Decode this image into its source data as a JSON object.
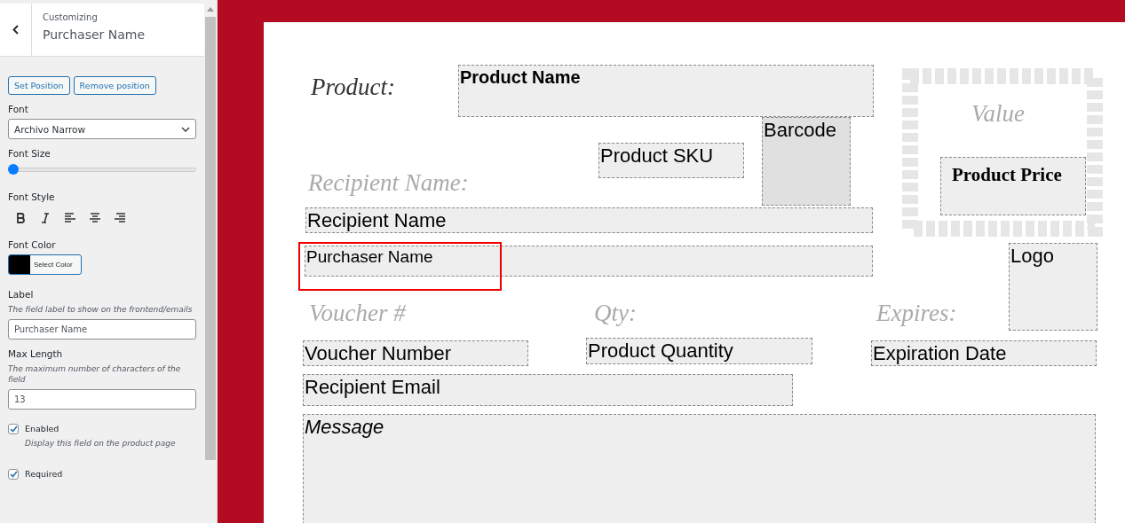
{
  "sidebar": {
    "header": {
      "breadcrumb": "Customizing",
      "title": "Purchaser Name"
    },
    "position_buttons": [
      "Set Position",
      "Remove position"
    ],
    "font": {
      "label": "Font",
      "value": "Archivo Narrow"
    },
    "font_size": {
      "label": "Font Size",
      "level": 0
    },
    "font_style": {
      "label": "Font Style",
      "buttons": [
        {
          "kind": "bold"
        },
        {
          "kind": "italic"
        },
        {
          "kind": "align-left"
        },
        {
          "kind": "align-center"
        },
        {
          "kind": "align-right"
        }
      ]
    },
    "font_color": {
      "label": "Font Color",
      "color": "#000000",
      "button": "Select Color"
    },
    "label_field": {
      "label": "Label",
      "description": "The field label to show on the frontend/emails",
      "value": "Purchaser Name"
    },
    "max_length": {
      "label": "Max Length",
      "description": "The maximum number of characters of the field",
      "value": "13"
    },
    "checkboxes": [
      {
        "label": "Enabled",
        "description": "Display this field on the product page",
        "checked": true
      },
      {
        "label": "Required",
        "checked": true
      }
    ]
  },
  "voucher": {
    "labels": [
      {
        "text": "Product:",
        "kind": "dark"
      },
      {
        "text": "Recipient Name:",
        "kind": "light"
      },
      {
        "text": "Value",
        "kind": "light"
      },
      {
        "text": "Voucher #",
        "kind": "light"
      },
      {
        "text": "Qty:",
        "kind": "light"
      },
      {
        "text": "Expires:",
        "kind": "light"
      }
    ],
    "fields": [
      {
        "text": "Product Name",
        "kind": "narrow-bold",
        "selected": false
      },
      {
        "text": "Barcode",
        "kind": "dark",
        "selected": false
      },
      {
        "text": "Product SKU",
        "kind": "plain",
        "selected": false
      },
      {
        "text": "Recipient Name",
        "kind": "plain",
        "selected": false
      },
      {
        "text": "Purchaser Name",
        "kind": "narrow",
        "selected": true
      },
      {
        "text": "Product Price",
        "kind": "serif-bold",
        "selected": false
      },
      {
        "text": "Logo",
        "kind": "plain",
        "selected": false
      },
      {
        "text": "Voucher Number",
        "kind": "plain",
        "selected": false
      },
      {
        "text": "Product Quantity",
        "kind": "plain",
        "selected": false
      },
      {
        "text": "Expiration Date",
        "kind": "plain",
        "selected": false
      },
      {
        "text": "Recipient Email",
        "kind": "plain",
        "selected": false
      },
      {
        "text": "Message",
        "kind": "italic",
        "selected": false
      }
    ]
  }
}
